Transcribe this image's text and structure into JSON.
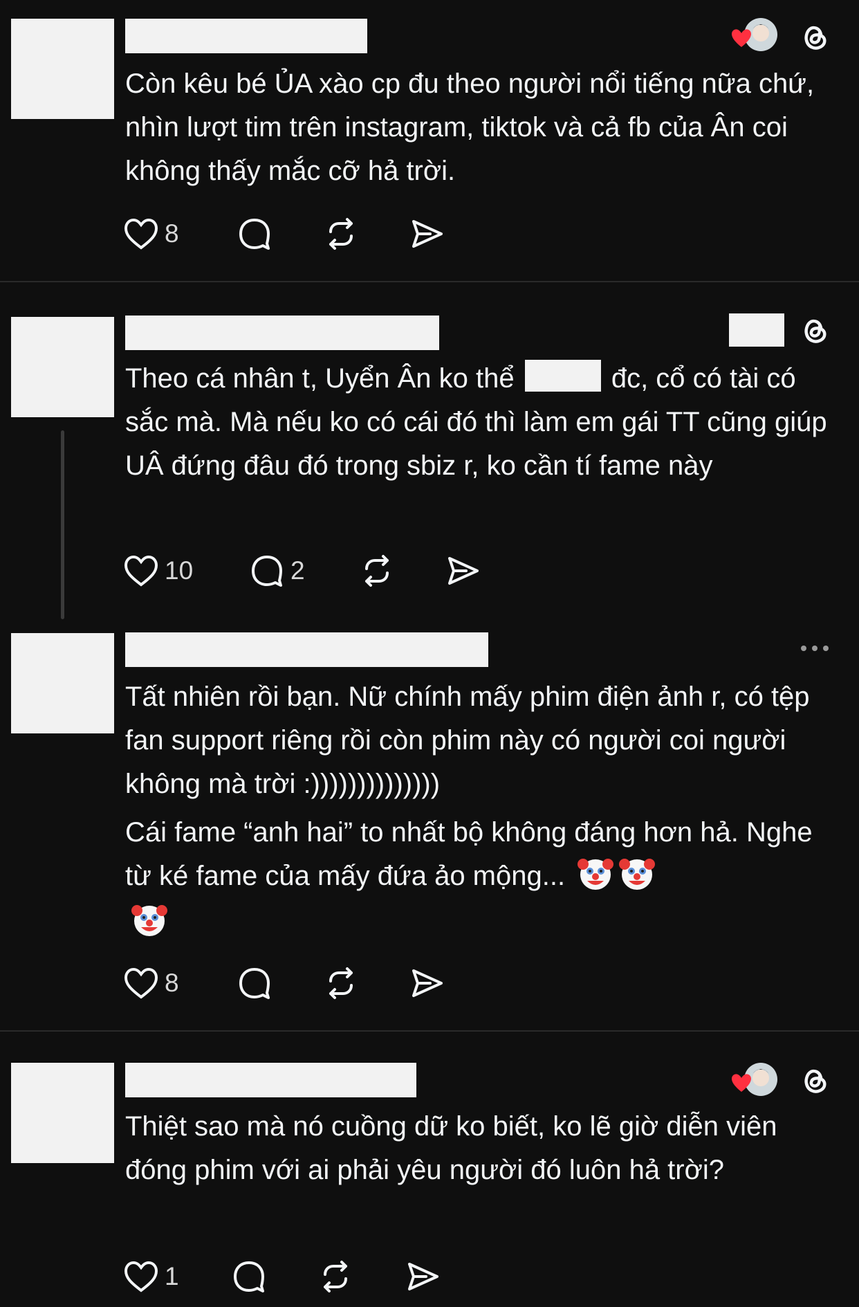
{
  "comments": [
    {
      "text": "Còn kêu bé ỦA xào cp đu theo người nổi tiếng nữa chứ, nhìn lượt tim trên instagram, tiktok và cả fb của Ân coi không thấy mắc cỡ hả trời.",
      "likes": "8",
      "replies": ""
    },
    {
      "text_before_redaction": "Theo cá nhân t, Uyển Ân ko thể ",
      "text_after_redaction": " đc, cổ có tài có sắc mà. Mà nếu ko có cái đó thì làm em gái TT cũng giúp UÂ đứng đâu đó trong sbiz r, ko cần tí fame này",
      "likes": "10",
      "replies": "2"
    },
    {
      "text": "Tất nhiên rồi bạn. Nữ chính mấy phim điện ảnh r, có tệp fan support riêng rồi còn phim này có người coi người không mà trời :))))))))))))))",
      "text2": "Cái fame “anh hai” to nhất bộ không đáng hơn hả. Nghe từ ké fame của mấy đứa ảo mộng... ",
      "likes": "8",
      "replies": ""
    },
    {
      "text": "Thiệt sao mà nó cuồng dữ ko biết, ko lẽ giờ diễn viên đóng phim với ai phải yêu người đó luôn hả trời?",
      "likes": "1",
      "replies": ""
    }
  ],
  "icons": [
    "heart-icon",
    "comment-icon",
    "repost-icon",
    "share-icon",
    "threads-logo-icon",
    "more-icon",
    "clown-emoji-icon"
  ],
  "colors": {
    "background": "#0f0f0f",
    "text": "#f3f5f7",
    "like_red": "#ff3040"
  }
}
